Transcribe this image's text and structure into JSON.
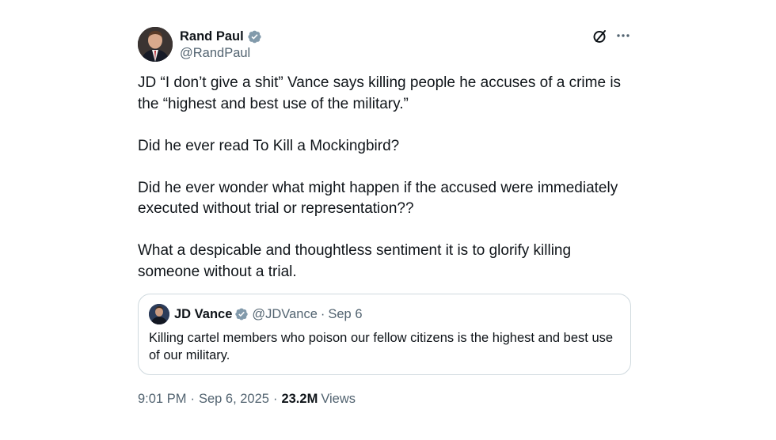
{
  "author": {
    "display_name": "Rand Paul",
    "handle": "@RandPaul",
    "avatar_icon": "avatar-rand-paul",
    "verified_color": "#1d9bf0"
  },
  "header_icons": {
    "grok": "grok-icon",
    "more": "more-icon"
  },
  "tweet": {
    "paragraphs": [
      "JD “I don’t give a shit” Vance says killing people he accuses of a crime is the “highest and best use of the military.”",
      "Did he ever read To Kill a Mockingbird?",
      "Did he ever wonder what might happen if the accused were immediately executed without trial or representation??",
      "What a despicable and thoughtless sentiment it is to glorify killing someone without a trial."
    ]
  },
  "quote": {
    "display_name": "JD Vance",
    "handle": "@JDVance",
    "separator": "·",
    "date": "Sep 6",
    "text": "Killing cartel members who poison our fellow citizens is the highest and best use of our military."
  },
  "meta": {
    "time": "9:01 PM",
    "dot": "·",
    "date": "Sep 6, 2025",
    "dot2": "·",
    "views_count": "23.2M",
    "views_label": "Views"
  }
}
